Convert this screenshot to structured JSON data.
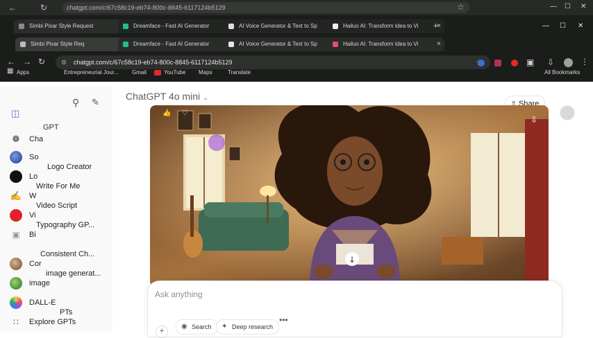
{
  "colors": {
    "chrome_bg": "#1b1d1b",
    "sidebar_bg": "#f9f9f9",
    "accent_cursor": "#9b3cdc"
  },
  "browser": {
    "ghost_url": "chatgpt.com/c/67c58c19-eb74-800c-8845-6117124b5129",
    "tabs_ghost": [
      {
        "label": "Simbi Pixar Style Request"
      },
      {
        "label": "Dreamface - Fast AI Generator"
      },
      {
        "label": "AI Voice Generator & Text to Sp"
      },
      {
        "label": "Hailuo AI: Transform Idea to Vi"
      }
    ],
    "tabs": [
      {
        "label": "Simbi Pixar Style Req"
      },
      {
        "label": "Dreamface - Fast AI Generator"
      },
      {
        "label": "AI Voice Generator & Text to Sp"
      },
      {
        "label": "Hailuo AI: Transform Idea to Vi"
      }
    ],
    "url": "chatgpt.com/c/67c58c19-eb74-800c-8845-6117124b5129",
    "bookmarks": [
      "Apps",
      "Entrepreneurial Jour...",
      "Gmail",
      "YouTube",
      "Maps",
      "Translate"
    ],
    "all_bookmarks": "All Bookmarks"
  },
  "sidebar": {
    "items": [
      {
        "label": "ChatGPT",
        "icon": "chatgpt-icon"
      },
      {
        "label": "Sora",
        "icon": "sora-icon"
      },
      {
        "label": "Logo Creator",
        "icon": "logo-creator-icon"
      },
      {
        "label": "Write For Me",
        "icon": "pen-icon"
      },
      {
        "label": "Video Script",
        "icon": "video-icon"
      },
      {
        "label": "Typography GP...",
        "icon": "typography-icon"
      },
      {
        "label": "Consistent Ch...",
        "icon": "character-icon"
      },
      {
        "label": "image generat...",
        "icon": "image-icon"
      },
      {
        "label": "DALL-E",
        "icon": "dalle-icon"
      },
      {
        "label": "Explore GPTs",
        "icon": "grid-icon"
      }
    ],
    "ghost_labels": [
      "Cha",
      "So",
      "Lo",
      "W",
      "Vi",
      "Bi",
      "Cor",
      "image",
      "PTs",
      "GPT"
    ]
  },
  "main": {
    "model_name": "ChatGPT 4o mini",
    "share_label": "Share",
    "composer_placeholder": "Ask anything",
    "search_label": "Search",
    "deep_research_label": "Deep research"
  }
}
